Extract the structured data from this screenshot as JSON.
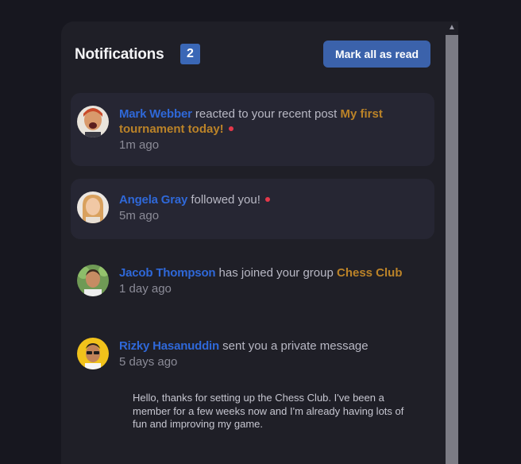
{
  "header": {
    "title": "Notifications",
    "unread_count": "2",
    "mark_all_label": "Mark all as read"
  },
  "notifications": [
    {
      "name": "Mark Webber",
      "action": "reacted to your recent post",
      "target": "My first tournament today!",
      "time": "1m ago",
      "unread": true
    },
    {
      "name": "Angela Gray",
      "action": "followed you!",
      "time": "5m ago",
      "unread": true
    },
    {
      "name": "Jacob Thompson",
      "action": "has joined your group",
      "target": "Chess Club",
      "time": "1 day ago",
      "unread": false
    },
    {
      "name": "Rizky Hasanuddin",
      "action": "sent you a private message",
      "time": "5 days ago",
      "unread": false,
      "message": "Hello, thanks for setting up the Chess Club. I've been a member for a few weeks now and I'm already having lots of fun and improving my game."
    }
  ],
  "colors": {
    "name": "#2f68d8",
    "target": "#bb8328",
    "unread_dot": "#e5384a",
    "badge": "#3a67b6",
    "button": "#3b62ab"
  },
  "icons": {
    "scroll_up": "chevron-up-icon",
    "avatar": "avatar"
  }
}
